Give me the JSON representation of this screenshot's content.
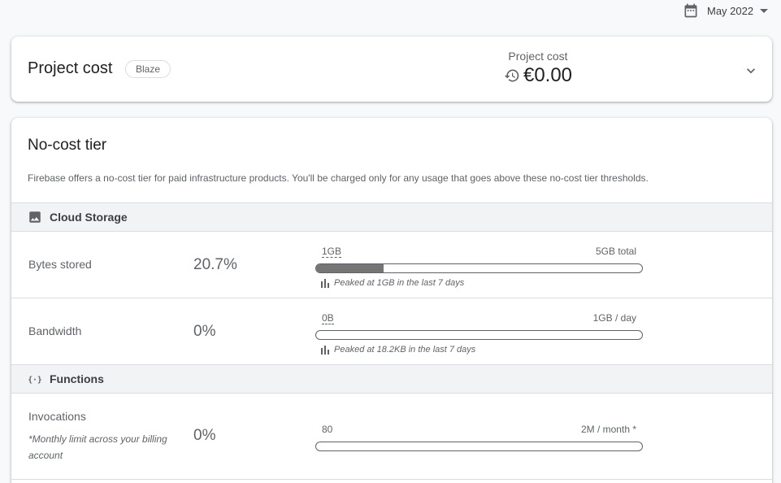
{
  "header": {
    "month": "May 2022"
  },
  "cost_card": {
    "title": "Project cost",
    "plan": "Blaze",
    "caption": "Project cost",
    "amount": "€0.00"
  },
  "tier": {
    "title": "No-cost tier",
    "description": "Firebase offers a no-cost tier for paid infrastructure products. You'll be charged only for any usage that goes above these no-cost tier thresholds."
  },
  "sections": {
    "storage": {
      "title": "Cloud Storage",
      "icon": "image-icon",
      "bytes": {
        "name": "Bytes stored",
        "percent": "20.7%",
        "fraction": 0.207,
        "used": "1GB",
        "total": "5GB total",
        "peak": "Peaked at 1GB in the last 7 days"
      },
      "bandwidth": {
        "name": "Bandwidth",
        "percent": "0%",
        "fraction": 0,
        "used": "0B",
        "total": "1GB / day",
        "peak": "Peaked at 18.2KB in the last 7 days"
      }
    },
    "functions": {
      "title": "Functions",
      "icon": "functions-icon",
      "invocations": {
        "name": "Invocations",
        "note": "*Monthly limit across your billing account",
        "percent": "0%",
        "fraction": 0,
        "used": "80",
        "total": "2M / month *"
      }
    }
  }
}
